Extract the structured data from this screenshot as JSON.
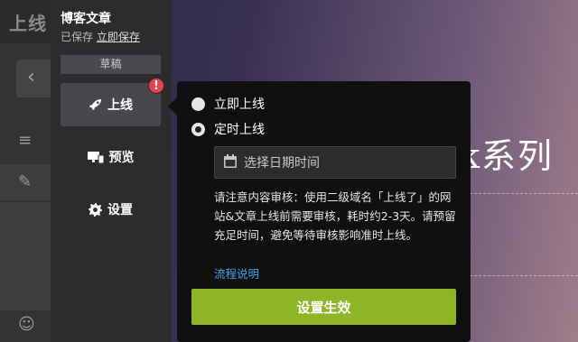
{
  "background": {
    "logo": "上线",
    "title_fragment": "k系列",
    "row_icons": [
      "≡",
      "✎",
      "☺"
    ]
  },
  "panel": {
    "title": "博客文章",
    "status_text": "已保存",
    "save_now_link": "立即保存",
    "draft_tag": "草稿",
    "alert_badge": "!",
    "nav": [
      {
        "label": "上线",
        "icon": "rocket-icon"
      },
      {
        "label": "预览",
        "icon": "monitor-icon"
      },
      {
        "label": "设置",
        "icon": "gear-icon"
      }
    ]
  },
  "popover": {
    "options": [
      {
        "label": "立即上线",
        "selected": false
      },
      {
        "label": "定时上线",
        "selected": true
      }
    ],
    "date_placeholder": "选择日期时间",
    "notice": "请注意内容审核：使用二级域名「上线了」的网站&文章上线前需要审核，耗时约2-3天。请预留充足时间，避免等待审核影响准时上线。",
    "flow_link": "流程说明",
    "apply_button": "设置生效"
  },
  "colors": {
    "accent_green": "#8db526",
    "link_blue": "#3aa4e8",
    "alert_red": "#e8414f"
  }
}
